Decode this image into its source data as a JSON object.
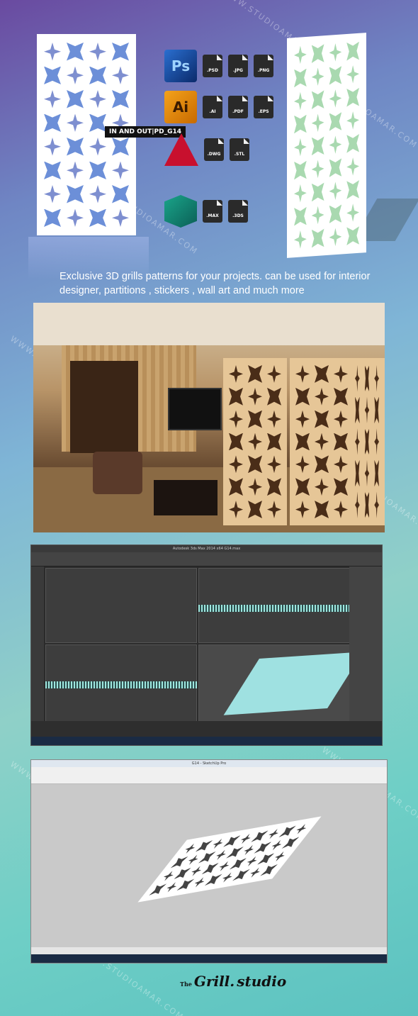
{
  "badge": "IN AND OUT|PD_G14",
  "watermark": "WWW.STUDIOAMAR.COM",
  "apps": [
    {
      "name": "Ps",
      "icon": "photoshop-icon",
      "files": [
        ".PSD",
        ".JPG",
        ".PNG"
      ]
    },
    {
      "name": "Ai",
      "icon": "illustrator-icon",
      "files": [
        ".AI",
        ".PDF",
        ".EPS"
      ]
    },
    {
      "name": "",
      "icon": "autocad-icon",
      "files": [
        ".DWG",
        ".STL"
      ]
    },
    {
      "name": "",
      "icon": "3dsmax-icon",
      "files": [
        ".MAX",
        ".3DS"
      ]
    }
  ],
  "tagline": "Exclusive  3D grills patterns for your projects.  can be used for interior designer, partitions , stickers , wall art and much more",
  "max_window_title": "Autodesk 3ds Max 2014 x64    G14.max",
  "sketchup_window_title": "G14 - SketchUp Pro",
  "logo": {
    "prefix": "The",
    "brand": "Grill.",
    "suffix": "studio"
  }
}
